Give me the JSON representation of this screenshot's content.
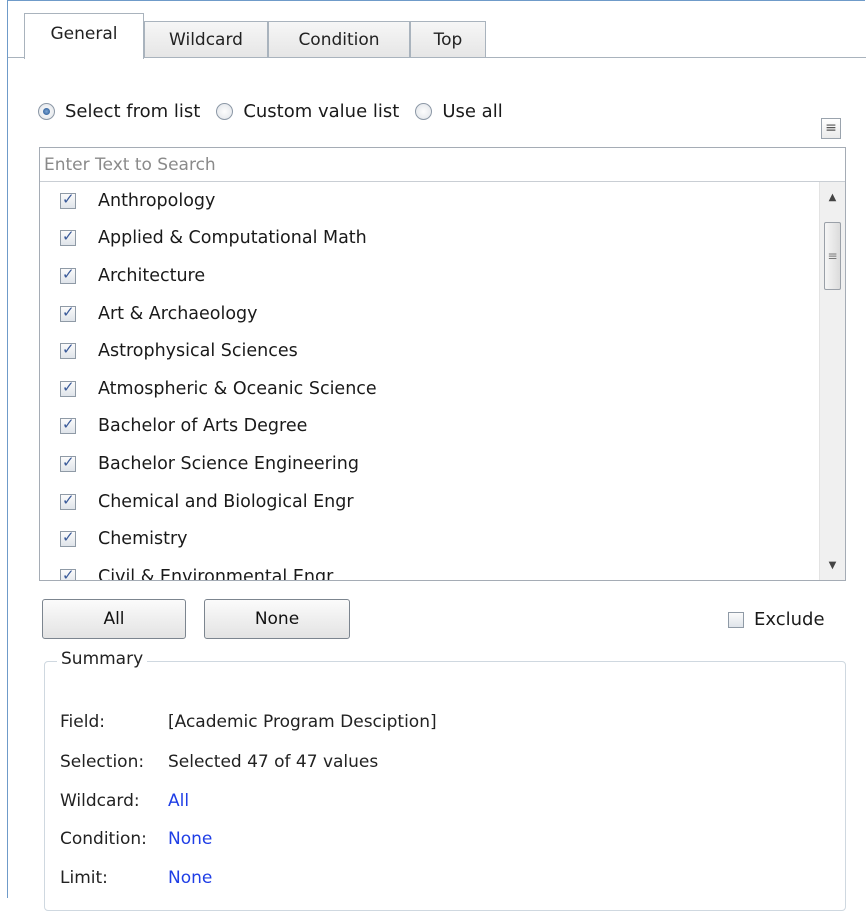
{
  "tabs": [
    {
      "label": "General",
      "active": true
    },
    {
      "label": "Wildcard",
      "active": false
    },
    {
      "label": "Condition",
      "active": false
    },
    {
      "label": "Top",
      "active": false
    }
  ],
  "selection_mode": {
    "options": [
      {
        "label": "Select from list",
        "checked": true
      },
      {
        "label": "Custom value list",
        "checked": false
      },
      {
        "label": "Use all",
        "checked": false
      }
    ]
  },
  "menu_icon": "hamburger-menu-icon",
  "search": {
    "placeholder": "Enter Text to Search",
    "value": ""
  },
  "list_items": [
    {
      "label": "Anthropology",
      "checked": true
    },
    {
      "label": "Applied & Computational Math",
      "checked": true
    },
    {
      "label": "Architecture",
      "checked": true
    },
    {
      "label": "Art & Archaeology",
      "checked": true
    },
    {
      "label": "Astrophysical Sciences",
      "checked": true
    },
    {
      "label": "Atmospheric & Oceanic Science",
      "checked": true
    },
    {
      "label": "Bachelor of Arts Degree",
      "checked": true
    },
    {
      "label": "Bachelor Science Engineering",
      "checked": true
    },
    {
      "label": "Chemical and Biological Engr",
      "checked": true
    },
    {
      "label": "Chemistry",
      "checked": true
    },
    {
      "label": "Civil & Environmental Engr",
      "checked": true
    }
  ],
  "buttons": {
    "all": "All",
    "none": "None"
  },
  "exclude": {
    "label": "Exclude",
    "checked": false
  },
  "summary": {
    "title": "Summary",
    "field_label": "Field:",
    "field_value": "[Academic Program Desciption]",
    "selection_label": "Selection:",
    "selection_value": "Selected 47 of 47 values",
    "wildcard_label": "Wildcard:",
    "wildcard_value": "All",
    "condition_label": "Condition:",
    "condition_value": "None",
    "limit_label": "Limit:",
    "limit_value": "None"
  },
  "colors": {
    "link": "#1f3ee6",
    "border_accent": "#6f9bc9"
  }
}
